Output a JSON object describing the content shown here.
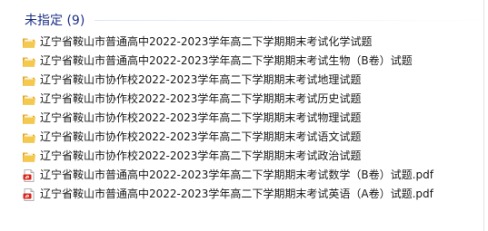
{
  "group": {
    "title": "未指定 (9)"
  },
  "files": [
    {
      "name": "辽宁省鞍山市普通高中2022-2023学年高二下学期期末考试化学试题",
      "icon": "folder-icon"
    },
    {
      "name": "辽宁省鞍山市普通高中2022-2023学年高二下学期期末考试生物（B卷）试题",
      "icon": "folder-icon"
    },
    {
      "name": "辽宁省鞍山市协作校2022-2023学年高二下学期期末考试地理试题",
      "icon": "folder-icon"
    },
    {
      "name": "辽宁省鞍山市协作校2022-2023学年高二下学期期末考试历史试题",
      "icon": "folder-icon"
    },
    {
      "name": "辽宁省鞍山市协作校2022-2023学年高二下学期期末考试物理试题",
      "icon": "folder-icon"
    },
    {
      "name": "辽宁省鞍山市协作校2022-2023学年高二下学期期末考试语文试题",
      "icon": "folder-icon"
    },
    {
      "name": "辽宁省鞍山市协作校2022-2023学年高二下学期期末考试政治试题",
      "icon": "folder-icon"
    },
    {
      "name": "辽宁省鞍山市普通高中2022-2023学年高二下学期期末考试数学（B卷）试题.pdf",
      "icon": "pdf-icon"
    },
    {
      "name": "辽宁省鞍山市普通高中2022-2023学年高二下学期期末考试英语（A卷）试题.pdf",
      "icon": "pdf-icon"
    }
  ],
  "colors": {
    "group_header": "#1e3287",
    "folder_front": "#f4c94e",
    "folder_back": "#e0a82a",
    "pdf_red": "#d9261c"
  }
}
